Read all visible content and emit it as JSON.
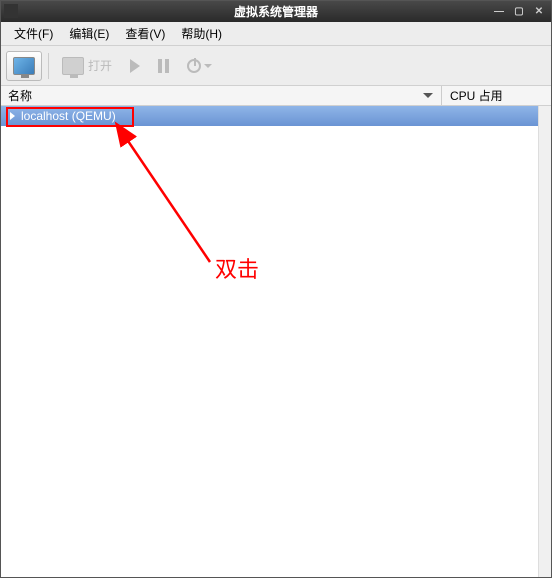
{
  "window": {
    "title": "虚拟系统管理器"
  },
  "menubar": {
    "file": "文件(F)",
    "edit": "编辑(E)",
    "view": "查看(V)",
    "help": "帮助(H)"
  },
  "toolbar": {
    "open": "打开"
  },
  "columns": {
    "name": "名称",
    "cpu": "CPU 占用"
  },
  "list": {
    "rows": [
      {
        "label": "localhost (QEMU)"
      }
    ]
  },
  "annotation": {
    "text": "双击"
  }
}
